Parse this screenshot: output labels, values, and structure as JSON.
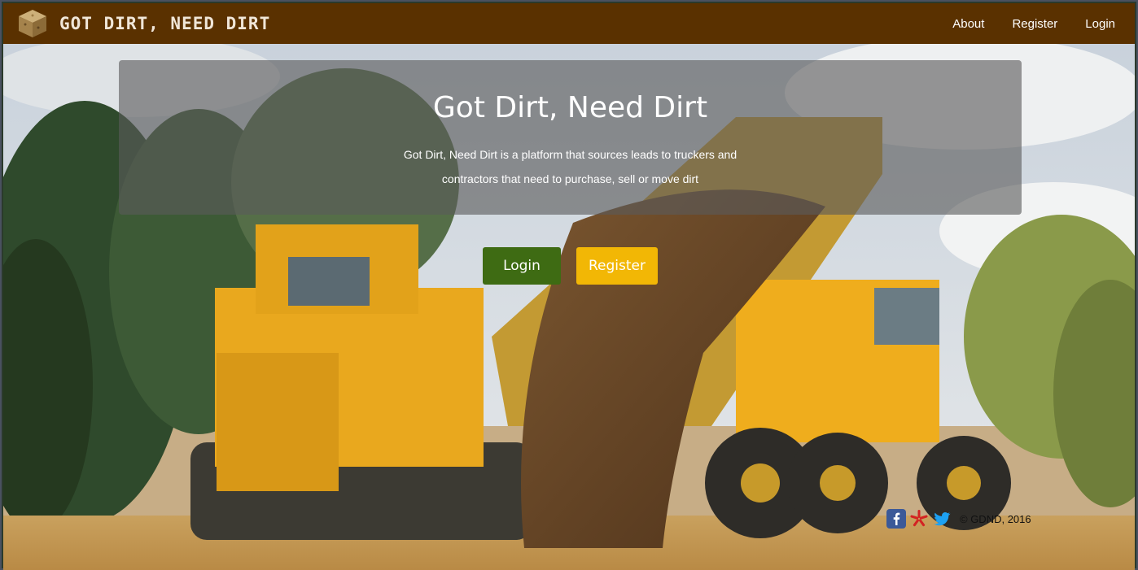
{
  "brand": {
    "name": "Got Dirt, Need Dirt",
    "logo_icon": "dirt-cube-icon"
  },
  "nav": {
    "links": [
      {
        "label": "About"
      },
      {
        "label": "Register"
      },
      {
        "label": "Login"
      }
    ]
  },
  "hero": {
    "title": "Got Dirt, Need Dirt",
    "description": "Got Dirt, Need Dirt is a platform that sources leads to truckers and contractors that need to purchase, sell or move dirt",
    "login_label": "Login",
    "register_label": "Register"
  },
  "footer": {
    "icons": [
      "facebook-icon",
      "yelp-icon",
      "twitter-icon"
    ],
    "copyright": "© GDND, 2016"
  },
  "colors": {
    "navbar": "#5a3100",
    "login_button": "#3e6b13",
    "register_button": "#f2b705"
  }
}
